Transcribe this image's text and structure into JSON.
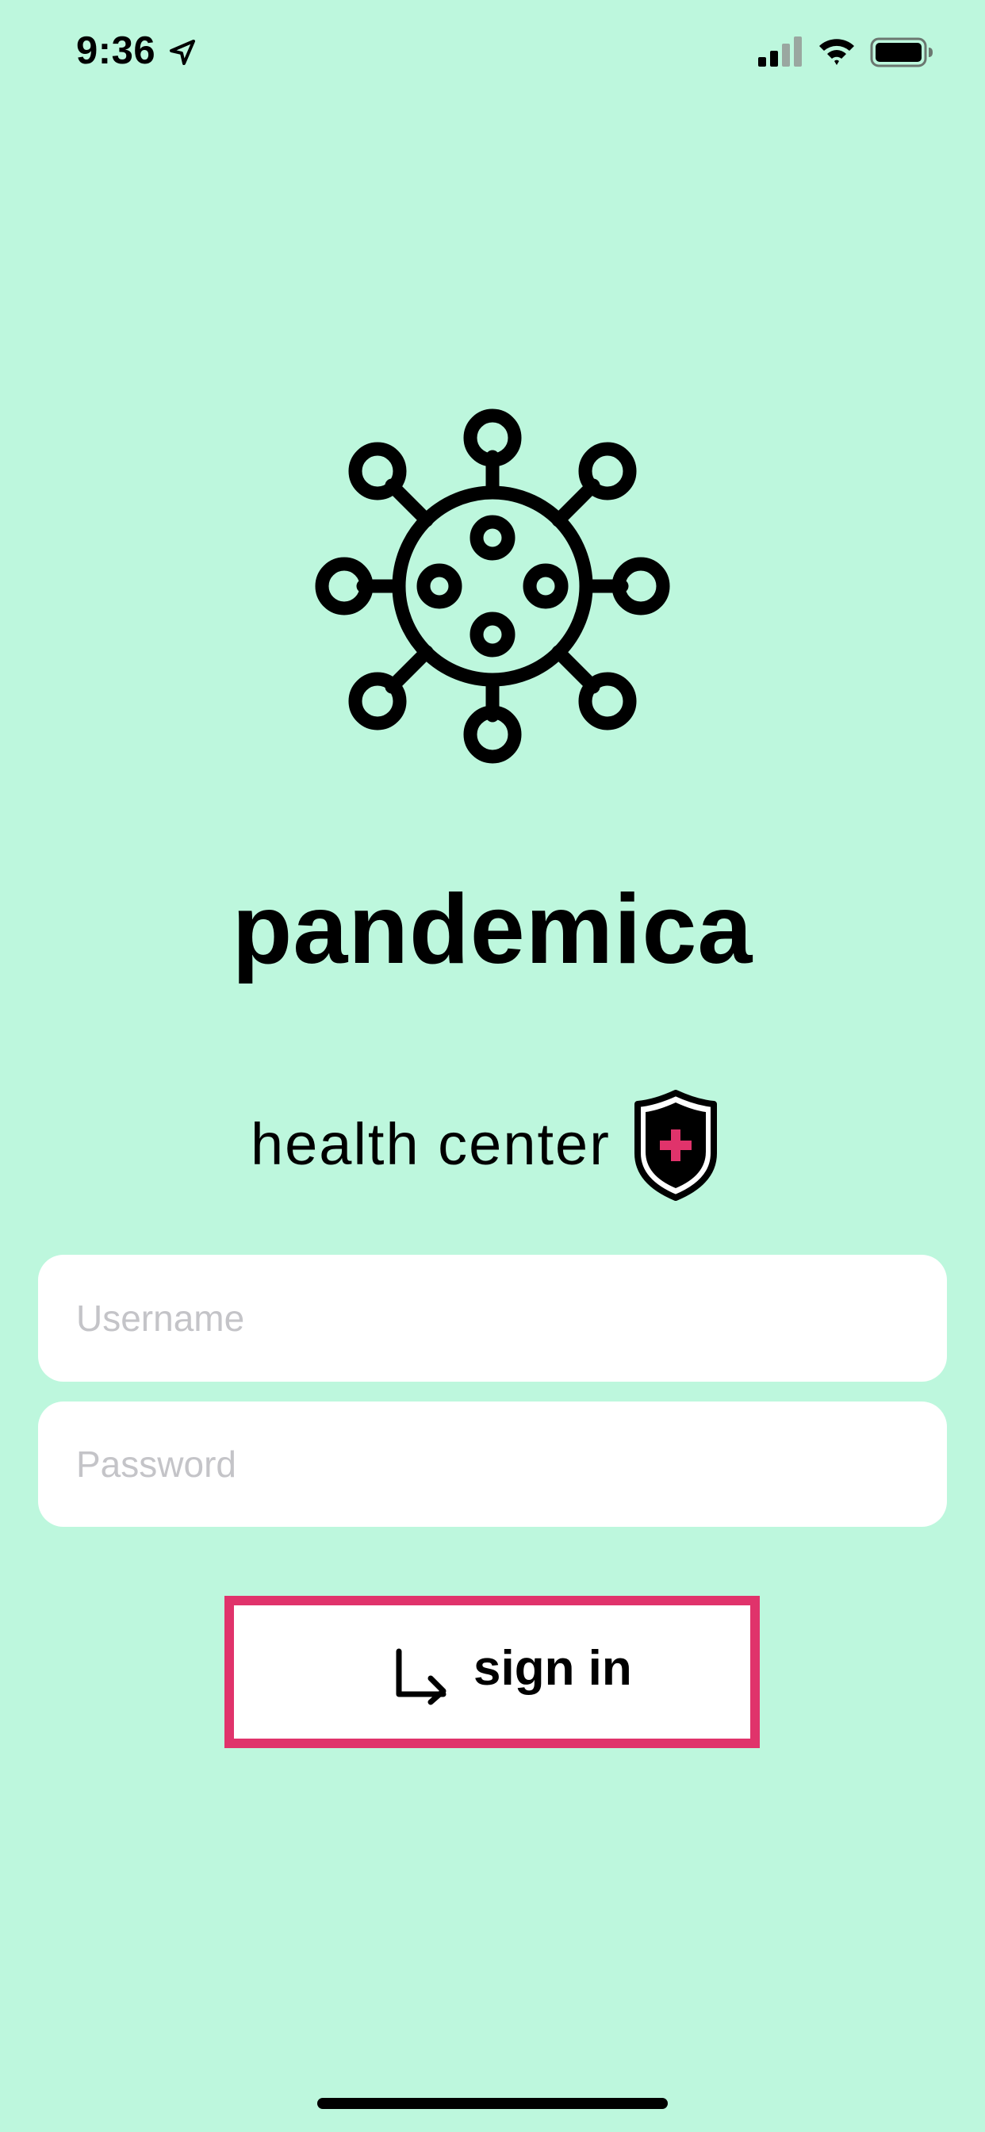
{
  "status_bar": {
    "time": "9:36",
    "icons": [
      "location-arrow-icon",
      "cellular-signal-icon",
      "wifi-icon",
      "battery-icon"
    ]
  },
  "logo": {
    "icon": "virus-icon"
  },
  "app": {
    "title": "pandemica",
    "subtitle": "health center",
    "subtitle_icon": "shield-plus-icon"
  },
  "form": {
    "username_placeholder": "Username",
    "username_value": "",
    "password_placeholder": "Password",
    "password_value": ""
  },
  "sign_in": {
    "label": "sign in",
    "icon": "arrow-turn-right-icon"
  },
  "colors": {
    "background": "#bdf7dd",
    "accent": "#e0336b",
    "input_background": "#ffffff",
    "placeholder": "#c4c4c8"
  }
}
